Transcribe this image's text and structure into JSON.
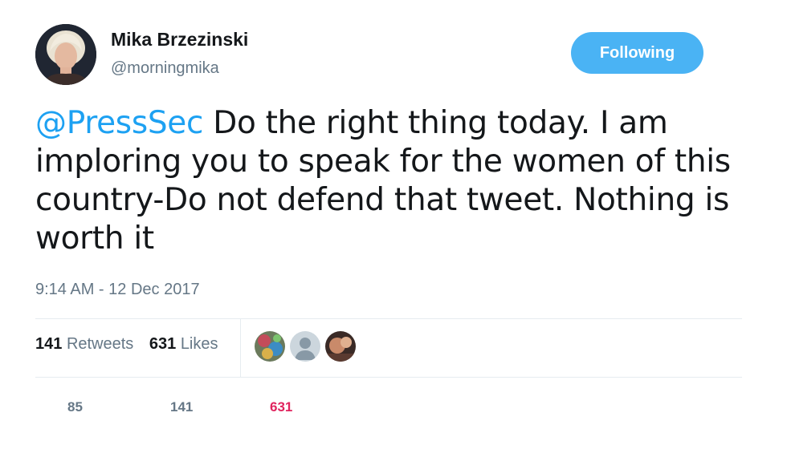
{
  "user": {
    "name": "Mika Brzezinski",
    "handle": "@morningmika"
  },
  "follow_button": {
    "label": "Following",
    "color": "#4ab3f4"
  },
  "tweet": {
    "mention": "@PressSec",
    "text": " Do the right thing today. I am imploring you to speak for the women of this country-Do not defend that tweet. Nothing is worth it",
    "timestamp": "9:14 AM - 12 Dec 2017"
  },
  "stats": {
    "retweets_count": "141",
    "retweets_label": "Retweets",
    "likes_count": "631",
    "likes_label": "Likes"
  },
  "actions": {
    "reply_count": "85",
    "retweet_count": "141",
    "like_count": "631",
    "like_color": "#e0245e"
  },
  "colors": {
    "mention": "#1da1f2",
    "secondary_text": "#657786",
    "divider": "#e6ecf0"
  }
}
